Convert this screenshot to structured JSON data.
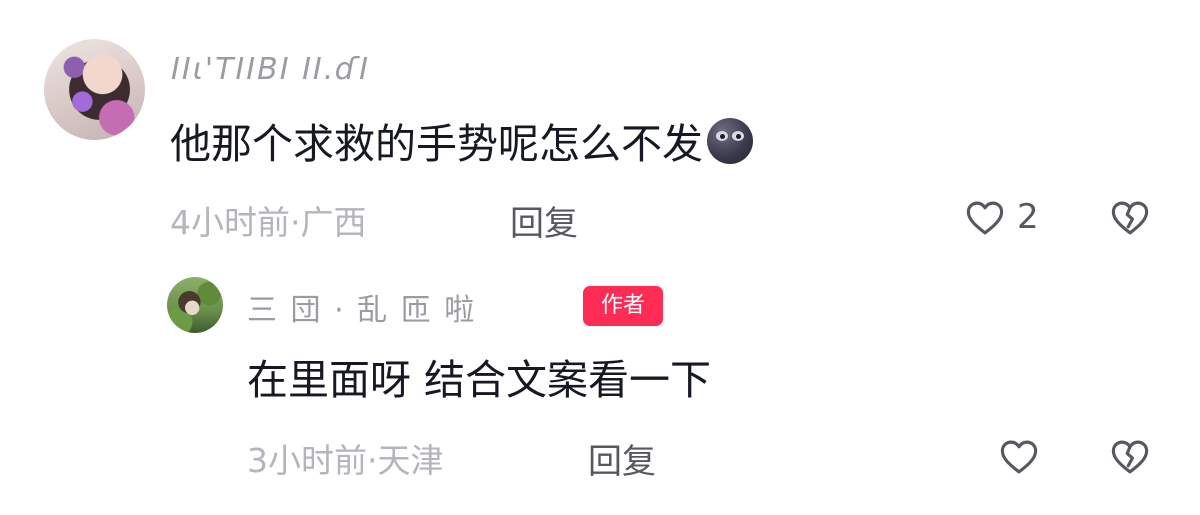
{
  "comment": {
    "username": "ΙΙι'ΤΙΙΒΙ ΙΙ.ɗΙ",
    "text": "他那个求救的手势呢怎么不发",
    "emoji": "new-moon-face-icon",
    "meta": "4小时前·广西",
    "reply_label": "回复",
    "like_count": "2"
  },
  "reply": {
    "username": "三 団  ·  乱 匝 啦",
    "author_badge": "作者",
    "text": "在里面呀 结合文案看一下",
    "meta": "3小时前·天津",
    "reply_label": "回复"
  },
  "colors": {
    "text_primary": "#161823",
    "text_secondary": "#b4b4ba",
    "action_text": "#57575f",
    "badge_bg": "#fe2c55"
  }
}
